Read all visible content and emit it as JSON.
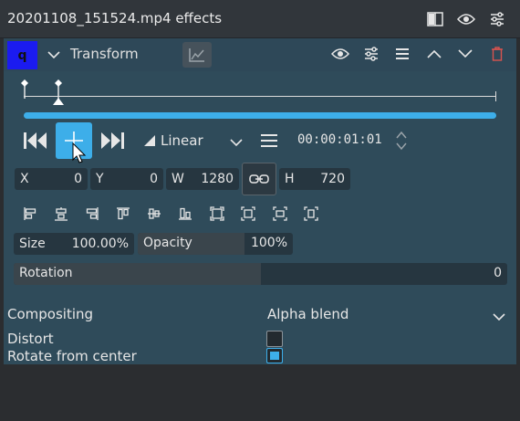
{
  "header": {
    "title": "20201108_151524.mp4 effects"
  },
  "effect": {
    "badge": "q",
    "name": "Transform"
  },
  "transport": {
    "interpolation": "Linear",
    "timecode": "00:00:01:01"
  },
  "geometry": {
    "x_label": "X",
    "x_value": "0",
    "y_label": "Y",
    "y_value": "0",
    "w_label": "W",
    "w_value": "1280",
    "h_label": "H",
    "h_value": "720"
  },
  "size": {
    "label": "Size",
    "value": "100.00%"
  },
  "opacity": {
    "label": "Opacity",
    "value": "100%",
    "fraction": 1.0
  },
  "rotation": {
    "label": "Rotation",
    "value": "0",
    "fraction": 0.5
  },
  "compositing": {
    "label": "Compositing",
    "value": "Alpha blend"
  },
  "distort": {
    "label": "Distort",
    "checked": false
  },
  "rotate_center": {
    "label": "Rotate from center",
    "checked": true
  },
  "colors": {
    "accent": "#3daee9",
    "badge": "#1b1bf0",
    "panel": "#2f4b5a"
  }
}
